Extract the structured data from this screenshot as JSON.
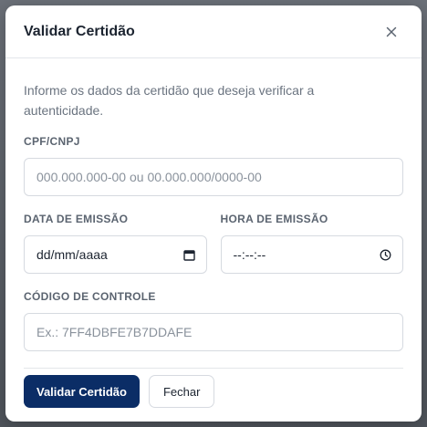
{
  "modal": {
    "title": "Validar Certidão",
    "close_icon": "close-icon",
    "description": "Informe os dados da certidão que deseja verificar a autenticidade.",
    "fields": {
      "cpf_cnpj": {
        "label": "CPF/CNPJ",
        "placeholder": "000.000.000-00 ou 00.000.000/0000-00"
      },
      "data_emissao": {
        "label": "DATA DE EMISSÃO",
        "value": "dd/mm/aaaa",
        "icon": "calendar-icon"
      },
      "hora_emissao": {
        "label": "HORA DE EMISSÃO",
        "value": "--:--:--",
        "icon": "clock-icon"
      },
      "codigo_controle": {
        "label": "CÓDIGO DE CONTROLE",
        "placeholder": "Ex.: 7FF4DBFE7B7DDAFE"
      }
    },
    "buttons": {
      "validate_label": "Validar Certidão",
      "close_label": "Fechar"
    }
  },
  "colors": {
    "primary": "#0b2d66",
    "border": "#d6dae0",
    "text": "#1c2430",
    "muted": "#6b7480"
  }
}
